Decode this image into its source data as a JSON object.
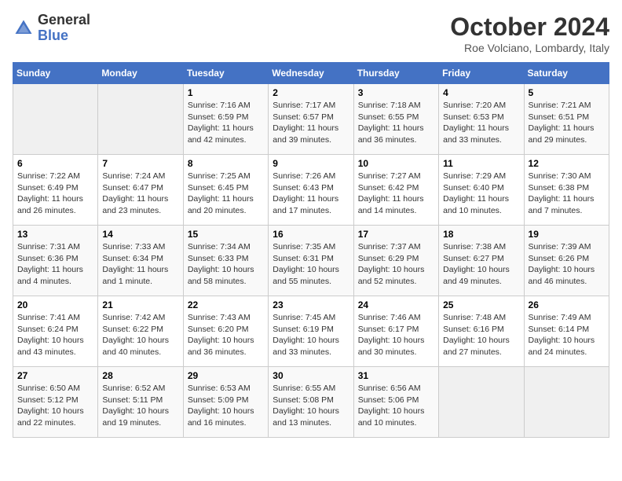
{
  "header": {
    "logo_general": "General",
    "logo_blue": "Blue",
    "month_title": "October 2024",
    "location": "Roe Volciano, Lombardy, Italy"
  },
  "weekdays": [
    "Sunday",
    "Monday",
    "Tuesday",
    "Wednesday",
    "Thursday",
    "Friday",
    "Saturday"
  ],
  "weeks": [
    [
      {
        "day": "",
        "sunrise": "",
        "sunset": "",
        "daylight": ""
      },
      {
        "day": "",
        "sunrise": "",
        "sunset": "",
        "daylight": ""
      },
      {
        "day": "1",
        "sunrise": "Sunrise: 7:16 AM",
        "sunset": "Sunset: 6:59 PM",
        "daylight": "Daylight: 11 hours and 42 minutes."
      },
      {
        "day": "2",
        "sunrise": "Sunrise: 7:17 AM",
        "sunset": "Sunset: 6:57 PM",
        "daylight": "Daylight: 11 hours and 39 minutes."
      },
      {
        "day": "3",
        "sunrise": "Sunrise: 7:18 AM",
        "sunset": "Sunset: 6:55 PM",
        "daylight": "Daylight: 11 hours and 36 minutes."
      },
      {
        "day": "4",
        "sunrise": "Sunrise: 7:20 AM",
        "sunset": "Sunset: 6:53 PM",
        "daylight": "Daylight: 11 hours and 33 minutes."
      },
      {
        "day": "5",
        "sunrise": "Sunrise: 7:21 AM",
        "sunset": "Sunset: 6:51 PM",
        "daylight": "Daylight: 11 hours and 29 minutes."
      }
    ],
    [
      {
        "day": "6",
        "sunrise": "Sunrise: 7:22 AM",
        "sunset": "Sunset: 6:49 PM",
        "daylight": "Daylight: 11 hours and 26 minutes."
      },
      {
        "day": "7",
        "sunrise": "Sunrise: 7:24 AM",
        "sunset": "Sunset: 6:47 PM",
        "daylight": "Daylight: 11 hours and 23 minutes."
      },
      {
        "day": "8",
        "sunrise": "Sunrise: 7:25 AM",
        "sunset": "Sunset: 6:45 PM",
        "daylight": "Daylight: 11 hours and 20 minutes."
      },
      {
        "day": "9",
        "sunrise": "Sunrise: 7:26 AM",
        "sunset": "Sunset: 6:43 PM",
        "daylight": "Daylight: 11 hours and 17 minutes."
      },
      {
        "day": "10",
        "sunrise": "Sunrise: 7:27 AM",
        "sunset": "Sunset: 6:42 PM",
        "daylight": "Daylight: 11 hours and 14 minutes."
      },
      {
        "day": "11",
        "sunrise": "Sunrise: 7:29 AM",
        "sunset": "Sunset: 6:40 PM",
        "daylight": "Daylight: 11 hours and 10 minutes."
      },
      {
        "day": "12",
        "sunrise": "Sunrise: 7:30 AM",
        "sunset": "Sunset: 6:38 PM",
        "daylight": "Daylight: 11 hours and 7 minutes."
      }
    ],
    [
      {
        "day": "13",
        "sunrise": "Sunrise: 7:31 AM",
        "sunset": "Sunset: 6:36 PM",
        "daylight": "Daylight: 11 hours and 4 minutes."
      },
      {
        "day": "14",
        "sunrise": "Sunrise: 7:33 AM",
        "sunset": "Sunset: 6:34 PM",
        "daylight": "Daylight: 11 hours and 1 minute."
      },
      {
        "day": "15",
        "sunrise": "Sunrise: 7:34 AM",
        "sunset": "Sunset: 6:33 PM",
        "daylight": "Daylight: 10 hours and 58 minutes."
      },
      {
        "day": "16",
        "sunrise": "Sunrise: 7:35 AM",
        "sunset": "Sunset: 6:31 PM",
        "daylight": "Daylight: 10 hours and 55 minutes."
      },
      {
        "day": "17",
        "sunrise": "Sunrise: 7:37 AM",
        "sunset": "Sunset: 6:29 PM",
        "daylight": "Daylight: 10 hours and 52 minutes."
      },
      {
        "day": "18",
        "sunrise": "Sunrise: 7:38 AM",
        "sunset": "Sunset: 6:27 PM",
        "daylight": "Daylight: 10 hours and 49 minutes."
      },
      {
        "day": "19",
        "sunrise": "Sunrise: 7:39 AM",
        "sunset": "Sunset: 6:26 PM",
        "daylight": "Daylight: 10 hours and 46 minutes."
      }
    ],
    [
      {
        "day": "20",
        "sunrise": "Sunrise: 7:41 AM",
        "sunset": "Sunset: 6:24 PM",
        "daylight": "Daylight: 10 hours and 43 minutes."
      },
      {
        "day": "21",
        "sunrise": "Sunrise: 7:42 AM",
        "sunset": "Sunset: 6:22 PM",
        "daylight": "Daylight: 10 hours and 40 minutes."
      },
      {
        "day": "22",
        "sunrise": "Sunrise: 7:43 AM",
        "sunset": "Sunset: 6:20 PM",
        "daylight": "Daylight: 10 hours and 36 minutes."
      },
      {
        "day": "23",
        "sunrise": "Sunrise: 7:45 AM",
        "sunset": "Sunset: 6:19 PM",
        "daylight": "Daylight: 10 hours and 33 minutes."
      },
      {
        "day": "24",
        "sunrise": "Sunrise: 7:46 AM",
        "sunset": "Sunset: 6:17 PM",
        "daylight": "Daylight: 10 hours and 30 minutes."
      },
      {
        "day": "25",
        "sunrise": "Sunrise: 7:48 AM",
        "sunset": "Sunset: 6:16 PM",
        "daylight": "Daylight: 10 hours and 27 minutes."
      },
      {
        "day": "26",
        "sunrise": "Sunrise: 7:49 AM",
        "sunset": "Sunset: 6:14 PM",
        "daylight": "Daylight: 10 hours and 24 minutes."
      }
    ],
    [
      {
        "day": "27",
        "sunrise": "Sunrise: 6:50 AM",
        "sunset": "Sunset: 5:12 PM",
        "daylight": "Daylight: 10 hours and 22 minutes."
      },
      {
        "day": "28",
        "sunrise": "Sunrise: 6:52 AM",
        "sunset": "Sunset: 5:11 PM",
        "daylight": "Daylight: 10 hours and 19 minutes."
      },
      {
        "day": "29",
        "sunrise": "Sunrise: 6:53 AM",
        "sunset": "Sunset: 5:09 PM",
        "daylight": "Daylight: 10 hours and 16 minutes."
      },
      {
        "day": "30",
        "sunrise": "Sunrise: 6:55 AM",
        "sunset": "Sunset: 5:08 PM",
        "daylight": "Daylight: 10 hours and 13 minutes."
      },
      {
        "day": "31",
        "sunrise": "Sunrise: 6:56 AM",
        "sunset": "Sunset: 5:06 PM",
        "daylight": "Daylight: 10 hours and 10 minutes."
      },
      {
        "day": "",
        "sunrise": "",
        "sunset": "",
        "daylight": ""
      },
      {
        "day": "",
        "sunrise": "",
        "sunset": "",
        "daylight": ""
      }
    ]
  ]
}
